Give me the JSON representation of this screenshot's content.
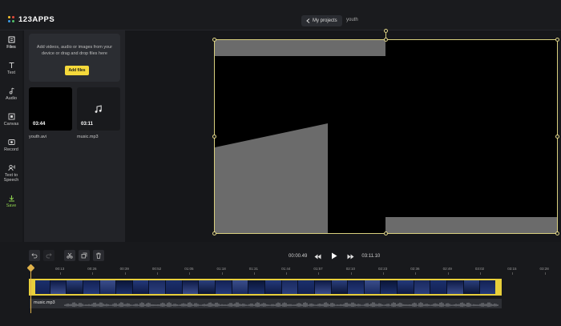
{
  "app": {
    "logo_text": "123APPS",
    "brand_dots": [
      "#f2c230",
      "#e64a3c",
      "#3b9be6",
      "#53c26b"
    ]
  },
  "header": {
    "my_projects_label": "My projects",
    "project_name": "youth"
  },
  "sidebar": {
    "items": [
      {
        "label": "Files",
        "icon": "folder-icon"
      },
      {
        "label": "Text",
        "icon": "text-icon"
      },
      {
        "label": "Audio",
        "icon": "music-note-icon"
      },
      {
        "label": "Canvas",
        "icon": "canvas-icon"
      },
      {
        "label": "Record",
        "icon": "record-icon"
      },
      {
        "label": "Text to Speech",
        "icon": "speech-icon"
      },
      {
        "label": "Save",
        "icon": "download-icon"
      }
    ]
  },
  "files_panel": {
    "drop_hint": "Add videos, audio or images from your device or drag and drop files here",
    "add_files_label": "Add files",
    "media": [
      {
        "name": "youth.avi",
        "duration": "03:44"
      },
      {
        "name": "music.mp3",
        "duration": "03:11"
      }
    ]
  },
  "player": {
    "current_time": "00:00.49",
    "total_time": "03:11.10"
  },
  "timeline": {
    "ruler": [
      "00:13",
      "00:26",
      "00:39",
      "00:52",
      "01:05",
      "01:18",
      "01:31",
      "01:44",
      "01:57",
      "02:10",
      "02:23",
      "02:36",
      "02:49",
      "03:02",
      "03:15",
      "03:28"
    ],
    "audio_track_name": "music.mp3"
  },
  "colors": {
    "accent": "#f5d93b",
    "save_green": "#8fd14f",
    "selection": "#d8cf7e"
  }
}
